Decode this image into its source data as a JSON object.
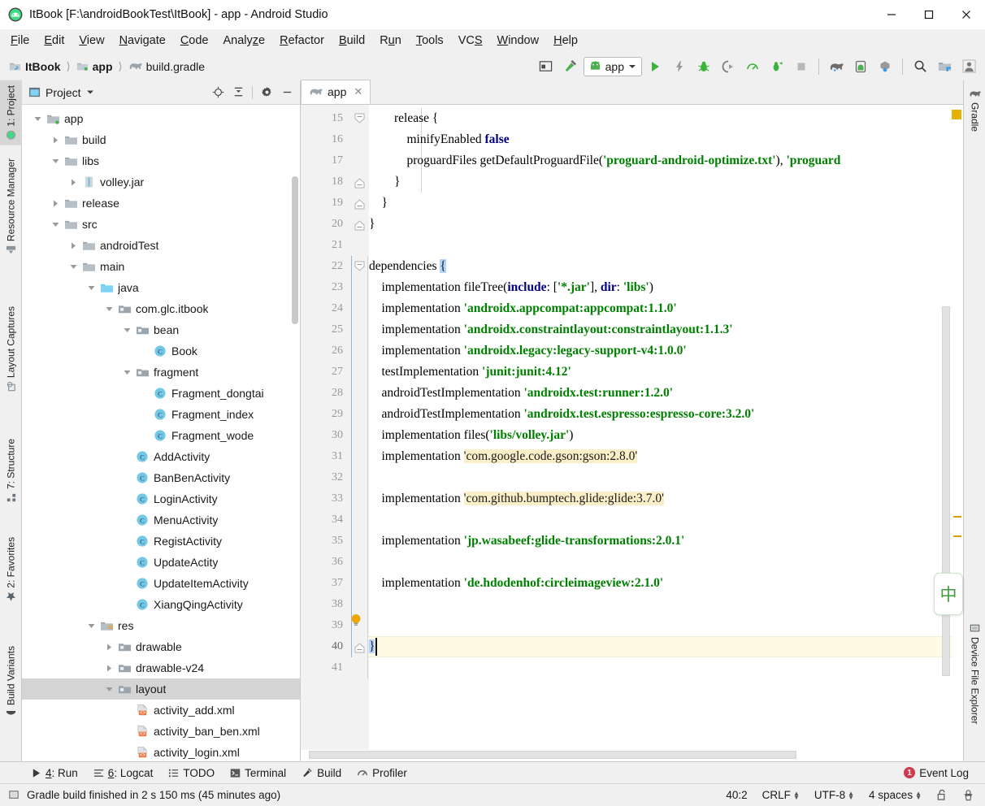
{
  "window": {
    "title": "ItBook [F:\\androidBookTest\\ItBook] - app - Android Studio",
    "minimize": "—",
    "maximize": "☐",
    "close": "✕"
  },
  "menubar": {
    "items": [
      {
        "label": "File",
        "mnemonic": "F"
      },
      {
        "label": "Edit",
        "mnemonic": "E"
      },
      {
        "label": "View",
        "mnemonic": "V"
      },
      {
        "label": "Navigate",
        "mnemonic": "N"
      },
      {
        "label": "Code",
        "mnemonic": "C"
      },
      {
        "label": "Analyze",
        "mnemonic": "z"
      },
      {
        "label": "Refactor",
        "mnemonic": "R"
      },
      {
        "label": "Build",
        "mnemonic": "B"
      },
      {
        "label": "Run",
        "mnemonic": "u"
      },
      {
        "label": "Tools",
        "mnemonic": "T"
      },
      {
        "label": "VCS",
        "mnemonic": "S"
      },
      {
        "label": "Window",
        "mnemonic": "W"
      },
      {
        "label": "Help",
        "mnemonic": "H"
      }
    ]
  },
  "toolbar": {
    "breadcrumb": [
      "ItBook",
      "app",
      "build.gradle"
    ],
    "run_config": "app",
    "icons": [
      "project-structure-icon",
      "build-hammer-icon",
      "run-icon",
      "apply-changes-icon",
      "debug-icon",
      "attach-debugger-icon",
      "profiler-icon",
      "run-with-coverage-icon",
      "stop-icon",
      "sdk-manager-icon",
      "avd-manager-icon",
      "sync-gradle-icon",
      "search-icon",
      "project-view-icon",
      "avatar-icon"
    ]
  },
  "left_rail": {
    "items": [
      {
        "label": "1: Project",
        "icon": "project-icon",
        "active": true
      },
      {
        "label": "Resource Manager",
        "icon": "resource-manager-icon",
        "active": false
      },
      {
        "label": "Layout Captures",
        "icon": "layout-captures-icon",
        "active": false
      },
      {
        "label": "7: Structure",
        "icon": "structure-icon",
        "active": false
      },
      {
        "label": "2: Favorites",
        "icon": "star-icon",
        "active": false
      },
      {
        "label": "Build Variants",
        "icon": "build-variants-icon",
        "active": false
      }
    ]
  },
  "right_rail": {
    "items": [
      {
        "label": "Gradle",
        "icon": "gradle-elephant-icon"
      },
      {
        "label": "Device File Explorer",
        "icon": "device-file-explorer-icon"
      }
    ]
  },
  "project_panel": {
    "title": "Project",
    "actions": [
      "locate-icon",
      "collapse-all-icon",
      "settings-gear-icon",
      "hide-icon"
    ],
    "tree": [
      {
        "depth": 1,
        "label": "app",
        "icon": "module-folder",
        "twist": "open"
      },
      {
        "depth": 2,
        "label": "build",
        "icon": "folder",
        "twist": "closed"
      },
      {
        "depth": 2,
        "label": "libs",
        "icon": "folder",
        "twist": "open"
      },
      {
        "depth": 3,
        "label": "volley.jar",
        "icon": "jar",
        "twist": "closed"
      },
      {
        "depth": 2,
        "label": "release",
        "icon": "folder",
        "twist": "closed"
      },
      {
        "depth": 2,
        "label": "src",
        "icon": "folder",
        "twist": "open"
      },
      {
        "depth": 3,
        "label": "androidTest",
        "icon": "folder",
        "twist": "closed"
      },
      {
        "depth": 3,
        "label": "main",
        "icon": "folder",
        "twist": "open"
      },
      {
        "depth": 4,
        "label": "java",
        "icon": "source-folder",
        "twist": "open"
      },
      {
        "depth": 5,
        "label": "com.glc.itbook",
        "icon": "package",
        "twist": "open"
      },
      {
        "depth": 6,
        "label": "bean",
        "icon": "package",
        "twist": "open"
      },
      {
        "depth": 7,
        "label": "Book",
        "icon": "class",
        "twist": "none"
      },
      {
        "depth": 6,
        "label": "fragment",
        "icon": "package",
        "twist": "open"
      },
      {
        "depth": 7,
        "label": "Fragment_dongtai",
        "icon": "class",
        "twist": "none"
      },
      {
        "depth": 7,
        "label": "Fragment_index",
        "icon": "class",
        "twist": "none"
      },
      {
        "depth": 7,
        "label": "Fragment_wode",
        "icon": "class",
        "twist": "none"
      },
      {
        "depth": 6,
        "label": "AddActivity",
        "icon": "class",
        "twist": "none"
      },
      {
        "depth": 6,
        "label": "BanBenActivity",
        "icon": "class",
        "twist": "none"
      },
      {
        "depth": 6,
        "label": "LoginActivity",
        "icon": "class",
        "twist": "none"
      },
      {
        "depth": 6,
        "label": "MenuActivity",
        "icon": "class",
        "twist": "none"
      },
      {
        "depth": 6,
        "label": "RegistActivity",
        "icon": "class",
        "twist": "none"
      },
      {
        "depth": 6,
        "label": "UpdateActity",
        "icon": "class",
        "twist": "none"
      },
      {
        "depth": 6,
        "label": "UpdateItemActivity",
        "icon": "class",
        "twist": "none"
      },
      {
        "depth": 6,
        "label": "XiangQingActivity",
        "icon": "class",
        "twist": "none"
      },
      {
        "depth": 4,
        "label": "res",
        "icon": "res-folder",
        "twist": "open"
      },
      {
        "depth": 5,
        "label": "drawable",
        "icon": "package",
        "twist": "closed"
      },
      {
        "depth": 5,
        "label": "drawable-v24",
        "icon": "package",
        "twist": "closed"
      },
      {
        "depth": 5,
        "label": "layout",
        "icon": "package",
        "twist": "open",
        "selected": true
      },
      {
        "depth": 6,
        "label": "activity_add.xml",
        "icon": "xml",
        "twist": "none"
      },
      {
        "depth": 6,
        "label": "activity_ban_ben.xml",
        "icon": "xml",
        "twist": "none"
      },
      {
        "depth": 6,
        "label": "activity_login.xml",
        "icon": "xml",
        "twist": "none"
      }
    ]
  },
  "editor": {
    "tab": {
      "label": "app",
      "icon": "gradle-elephant-icon",
      "close": "✕"
    },
    "first_line_number": 15,
    "lines": [
      {
        "n": 15,
        "fold": "open-start",
        "tokens": [
          {
            "t": "        release {",
            "c": "plain"
          }
        ]
      },
      {
        "n": 16,
        "fold": "none",
        "tokens": [
          {
            "t": "            minifyEnabled ",
            "c": "plain"
          },
          {
            "t": "false",
            "c": "kw"
          }
        ]
      },
      {
        "n": 17,
        "fold": "none",
        "tokens": [
          {
            "t": "            proguardFiles getDefaultProguardFile(",
            "c": "plain"
          },
          {
            "t": "'proguard-android-optimize.txt'",
            "c": "str"
          },
          {
            "t": "), ",
            "c": "plain"
          },
          {
            "t": "'proguard",
            "c": "str"
          }
        ]
      },
      {
        "n": 18,
        "fold": "open-end",
        "tokens": [
          {
            "t": "        }",
            "c": "plain"
          }
        ]
      },
      {
        "n": 19,
        "fold": "open-end",
        "tokens": [
          {
            "t": "    }",
            "c": "plain"
          }
        ]
      },
      {
        "n": 20,
        "fold": "open-end",
        "tokens": [
          {
            "t": "}",
            "c": "plain"
          }
        ]
      },
      {
        "n": 21,
        "fold": "none",
        "tokens": []
      },
      {
        "n": 22,
        "fold": "open-start",
        "tokens": [
          {
            "t": "dependencies ",
            "c": "plain"
          },
          {
            "t": "{",
            "c": "bracehl"
          }
        ]
      },
      {
        "n": 23,
        "fold": "none",
        "tokens": [
          {
            "t": "    implementation fileTree(",
            "c": "plain"
          },
          {
            "t": "include",
            "c": "kw"
          },
          {
            "t": ": [",
            "c": "plain"
          },
          {
            "t": "'*.jar'",
            "c": "str"
          },
          {
            "t": "], ",
            "c": "plain"
          },
          {
            "t": "dir",
            "c": "kw"
          },
          {
            "t": ": ",
            "c": "plain"
          },
          {
            "t": "'libs'",
            "c": "str"
          },
          {
            "t": ")",
            "c": "plain"
          }
        ]
      },
      {
        "n": 24,
        "fold": "none",
        "tokens": [
          {
            "t": "    implementation ",
            "c": "plain"
          },
          {
            "t": "'androidx.appcompat:appcompat:1.1.0'",
            "c": "str"
          }
        ]
      },
      {
        "n": 25,
        "fold": "none",
        "tokens": [
          {
            "t": "    implementation ",
            "c": "plain"
          },
          {
            "t": "'androidx.constraintlayout:constraintlayout:1.1.3'",
            "c": "str"
          }
        ]
      },
      {
        "n": 26,
        "fold": "none",
        "tokens": [
          {
            "t": "    implementation ",
            "c": "plain"
          },
          {
            "t": "'androidx.legacy:legacy-support-v4:1.0.0'",
            "c": "str"
          }
        ]
      },
      {
        "n": 27,
        "fold": "none",
        "tokens": [
          {
            "t": "    testImplementation ",
            "c": "plain"
          },
          {
            "t": "'junit:junit:4.12'",
            "c": "str"
          }
        ]
      },
      {
        "n": 28,
        "fold": "none",
        "tokens": [
          {
            "t": "    androidTestImplementation ",
            "c": "plain"
          },
          {
            "t": "'androidx.test:runner:1.2.0'",
            "c": "str"
          }
        ]
      },
      {
        "n": 29,
        "fold": "none",
        "tokens": [
          {
            "t": "    androidTestImplementation ",
            "c": "plain"
          },
          {
            "t": "'androidx.test.espresso:espresso-core:3.2.0'",
            "c": "str"
          }
        ]
      },
      {
        "n": 30,
        "fold": "none",
        "tokens": [
          {
            "t": "    implementation files(",
            "c": "plain"
          },
          {
            "t": "'libs/volley.jar'",
            "c": "str"
          },
          {
            "t": ")",
            "c": "plain"
          }
        ]
      },
      {
        "n": 31,
        "fold": "none",
        "tokens": [
          {
            "t": "    implementation ",
            "c": "plain"
          },
          {
            "t": "'com.google.code.gson:gson:2.8.0'",
            "c": "strhl"
          }
        ]
      },
      {
        "n": 32,
        "fold": "none",
        "tokens": []
      },
      {
        "n": 33,
        "fold": "none",
        "tokens": [
          {
            "t": "    implementation ",
            "c": "plain"
          },
          {
            "t": "'com.github.bumptech.glide:glide:3.7.0'",
            "c": "strhl"
          }
        ]
      },
      {
        "n": 34,
        "fold": "none",
        "tokens": []
      },
      {
        "n": 35,
        "fold": "none",
        "tokens": [
          {
            "t": "    implementation ",
            "c": "plain"
          },
          {
            "t": "'jp.wasabeef:glide-transformations:2.0.1'",
            "c": "str"
          }
        ]
      },
      {
        "n": 36,
        "fold": "none",
        "tokens": []
      },
      {
        "n": 37,
        "fold": "none",
        "tokens": [
          {
            "t": "    implementation ",
            "c": "plain"
          },
          {
            "t": "'de.hdodenhof:circleimageview:2.1.0'",
            "c": "str"
          }
        ]
      },
      {
        "n": 38,
        "fold": "none",
        "tokens": []
      },
      {
        "n": 39,
        "fold": "none",
        "tokens": []
      },
      {
        "n": 40,
        "fold": "open-end",
        "tokens": [
          {
            "t": "}",
            "c": "bracehl"
          }
        ],
        "current": true
      },
      {
        "n": 41,
        "fold": "none",
        "tokens": []
      }
    ],
    "intention_bulb": "lightbulb-icon",
    "ime_badge": "中"
  },
  "bottom_bar": {
    "items": [
      {
        "label": "4: Run",
        "mnemonic": "4",
        "icon": "run-icon"
      },
      {
        "label": "6: Logcat",
        "mnemonic": "6",
        "icon": "logcat-icon"
      },
      {
        "label": "TODO",
        "mnemonic": "",
        "icon": "todo-icon"
      },
      {
        "label": "Terminal",
        "mnemonic": "",
        "icon": "terminal-icon"
      },
      {
        "label": "Build",
        "mnemonic": "",
        "icon": "build-hammer-icon"
      },
      {
        "label": "Profiler",
        "mnemonic": "",
        "icon": "profiler-icon"
      }
    ],
    "event_log": {
      "label": "Event Log",
      "count": "1"
    }
  },
  "status_bar": {
    "message": "Gradle build finished in 2 s 150 ms (45 minutes ago)",
    "caret_position": "40:2",
    "line_separator": "CRLF",
    "encoding": "UTF-8",
    "indent": "4 spaces",
    "lock_icon": "unlocked-padlock-icon",
    "inspector_icon": "hector-inspection-icon"
  },
  "colors": {
    "accent_green": "#3c9a3c",
    "string_green": "#008000",
    "keyword_navy": "#000080",
    "highlight_yellow": "#faefc8",
    "current_line": "#fffae3",
    "selection_blue": "#b3d4fc",
    "badge_red": "#d0394e"
  }
}
